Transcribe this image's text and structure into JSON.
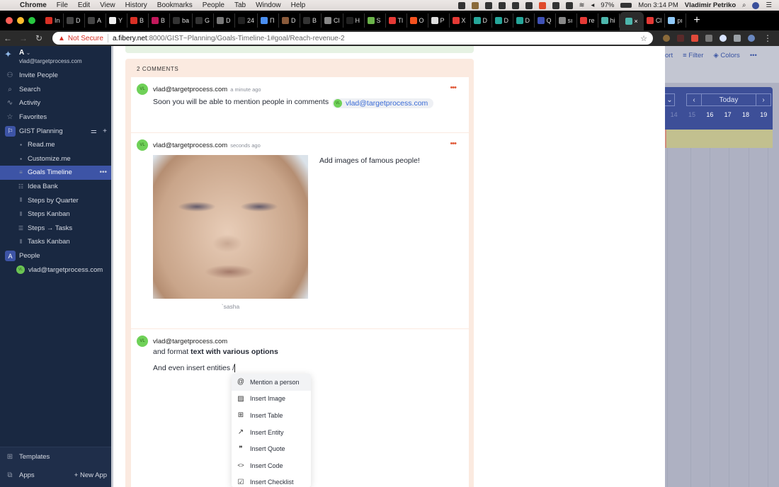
{
  "menubar": {
    "app": "Chrome",
    "items": [
      "File",
      "Edit",
      "View",
      "History",
      "Bookmarks",
      "People",
      "Tab",
      "Window",
      "Help"
    ],
    "battery": "97%",
    "clock": "Mon 3:14 PM",
    "user": "Vladimir Petriko"
  },
  "tabs": [
    {
      "label": "In",
      "color": "#d93025"
    },
    {
      "label": "D",
      "color": "#444"
    },
    {
      "label": "A",
      "color": "#444"
    },
    {
      "label": "Y",
      "color": "#eee"
    },
    {
      "label": "B",
      "color": "#d93025"
    },
    {
      "label": "B",
      "color": "#c2185b"
    },
    {
      "label": "ba",
      "color": "#333"
    },
    {
      "label": "G",
      "color": "#333"
    },
    {
      "label": "D",
      "color": "#777"
    },
    {
      "label": "24",
      "color": "#222"
    },
    {
      "label": "П",
      "color": "#4a8ef0"
    },
    {
      "label": "D",
      "color": "#8a5a3a"
    },
    {
      "label": "B",
      "color": "#333"
    },
    {
      "label": "Cl",
      "color": "#888"
    },
    {
      "label": "H",
      "color": "#222"
    },
    {
      "label": "S",
      "color": "#6bb34a"
    },
    {
      "label": "Tl",
      "color": "#e53935"
    },
    {
      "label": "O",
      "color": "#f4511e"
    },
    {
      "label": "P",
      "color": "#ddd"
    },
    {
      "label": "X",
      "color": "#e53935"
    },
    {
      "label": "D",
      "color": "#26a69a"
    },
    {
      "label": "D",
      "color": "#26a69a"
    },
    {
      "label": "D",
      "color": "#26a69a"
    },
    {
      "label": "Q",
      "color": "#3f51b5"
    },
    {
      "label": "sı",
      "color": "#888"
    },
    {
      "label": "re",
      "color": "#e53935"
    },
    {
      "label": "hi",
      "color": "#4db6ac"
    }
  ],
  "active_tab": {
    "label": "×",
    "color": "#4db6ac"
  },
  "tabs_after": [
    {
      "label": "Cl",
      "color": "#e53935"
    },
    {
      "label": "pı",
      "color": "#90caf9"
    }
  ],
  "address_bar": {
    "security": "Not Secure",
    "host": "a.fibery.net",
    "path": ":8000/GIST~Planning/Goals-Timeline-1#goal/Reach-revenue-2"
  },
  "sidebar": {
    "workspace_name": "A",
    "workspace_email": "vlad@targetprocess.com",
    "nav": [
      {
        "label": "Invite People",
        "icon": "people-icon"
      },
      {
        "label": "Search",
        "icon": "search-icon"
      },
      {
        "label": "Activity",
        "icon": "activity-icon"
      },
      {
        "label": "Favorites",
        "icon": "star-icon"
      }
    ],
    "app": {
      "label": "GIST Planning",
      "icon": "gist-app-icon"
    },
    "views": [
      {
        "label": "Read.me",
        "icon": "document-icon"
      },
      {
        "label": "Customize.me",
        "icon": "document-icon"
      },
      {
        "label": "Goals Timeline",
        "icon": "timeline-icon",
        "active": true
      },
      {
        "label": "Idea Bank",
        "icon": "table-icon"
      },
      {
        "label": "Steps by Quarter",
        "icon": "board-icon"
      },
      {
        "label": "Steps Kanban",
        "icon": "board-icon"
      },
      {
        "label": "Steps → Tasks",
        "icon": "list-icon"
      },
      {
        "label": "Tasks Kanban",
        "icon": "board-icon"
      }
    ],
    "people_app": {
      "label": "People",
      "icon": "people-app-icon"
    },
    "people": [
      {
        "label": "vlad@targetprocess.com",
        "initials": "VL"
      }
    ],
    "templates_label": "Templates",
    "apps_label": "Apps",
    "new_app_label": "+ New App"
  },
  "right_pane": {
    "toolbar": [
      "ort",
      "Filter",
      "Colors"
    ],
    "today_label": "Today",
    "days": [
      "14",
      "15",
      "16",
      "17",
      "18",
      "19"
    ],
    "accent": "#3d4f98"
  },
  "comments": {
    "title": "2 COMMENTS",
    "items": [
      {
        "author": "vlad@targetprocess.com",
        "initials": "VL",
        "time": "a minute ago",
        "text": "Soon you will be able to mention people in comments",
        "mention": "vlad@targetprocess.com"
      },
      {
        "author": "vlad@targetprocess.com",
        "initials": "VL",
        "time": "seconds ago",
        "image_caption": "`sasha",
        "text": "Add images of famous people!"
      },
      {
        "author": "vlad@targetprocess.com",
        "initials": "VL",
        "text_plain": "and format ",
        "text_bold": "text with various options",
        "text_line2": "And even insert entities /"
      }
    ]
  },
  "slash_menu": [
    {
      "label": "Mention a person",
      "icon": "at-icon",
      "glyph": "@"
    },
    {
      "label": "Insert Image",
      "icon": "image-icon",
      "glyph": "▨"
    },
    {
      "label": "Insert Table",
      "icon": "table-icon",
      "glyph": "⊞"
    },
    {
      "label": "Insert Entity",
      "icon": "arrow-up-right-icon",
      "glyph": "↗"
    },
    {
      "label": "Insert Quote",
      "icon": "quote-icon",
      "glyph": "❞"
    },
    {
      "label": "Insert Code",
      "icon": "code-icon",
      "glyph": "<>"
    },
    {
      "label": "Insert Checklist",
      "icon": "checklist-icon",
      "glyph": "☑"
    }
  ]
}
